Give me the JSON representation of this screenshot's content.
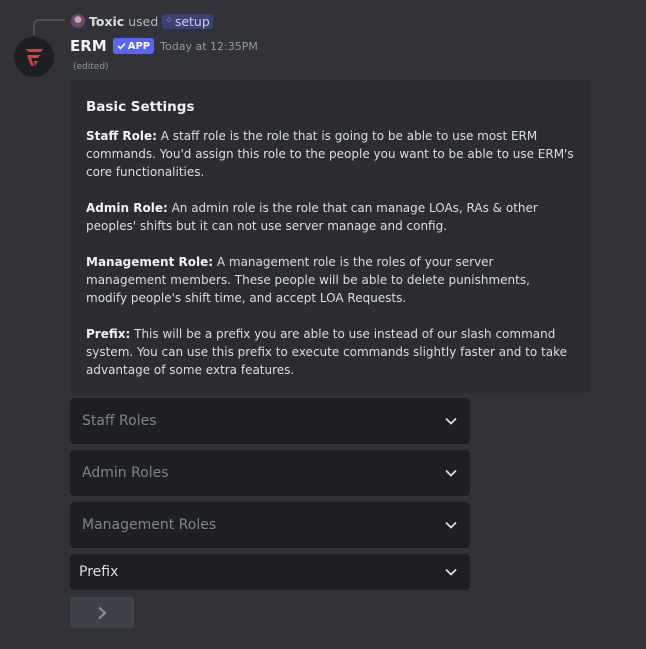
{
  "reply": {
    "username": "Toxic",
    "used_text": "used",
    "command": "setup"
  },
  "message": {
    "bot_name": "ERM",
    "app_tag": "APP",
    "timestamp": "Today at 12:35PM",
    "edited": "(edited)"
  },
  "embed": {
    "title": "Basic Settings",
    "sections": [
      {
        "label": "Staff Role:",
        "text": " A staff role is the role that is going to be able to use most ERM commands. You'd assign this role to the people you want to be able to use ERM's core functionalities."
      },
      {
        "label": "Admin Role:",
        "text": " An admin role is the role that can manage LOAs, RAs & other peoples' shifts but it can not use server manage and config."
      },
      {
        "label": "Management Role:",
        "text": " A management role is the roles of your server management members. These people will be able to delete punishments, modify people's shift time, and accept LOA Requests."
      },
      {
        "label": "Prefix:",
        "text": " This will be a prefix you are able to use instead of our slash command system. You can use this prefix to execute commands slightly faster and to take advantage of some extra features."
      }
    ]
  },
  "selects": {
    "staff": "Staff Roles",
    "admin": "Admin Roles",
    "management": "Management Roles",
    "prefix": "Prefix"
  },
  "colors": {
    "background": "#313338",
    "embed": "#2b2d31",
    "select": "#1e1f22",
    "accent": "#5865f2",
    "brand_red": "#e03a3e"
  }
}
